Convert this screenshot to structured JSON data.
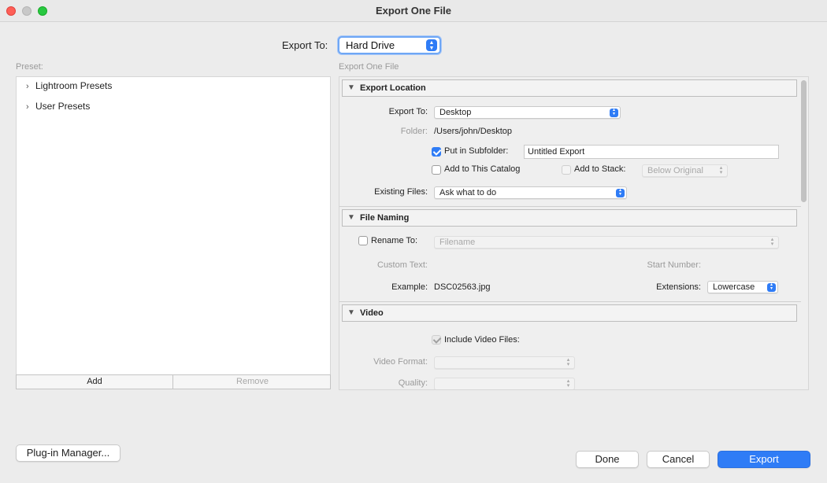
{
  "window": {
    "title": "Export One File"
  },
  "export_to": {
    "label": "Export To:",
    "value": "Hard Drive"
  },
  "preset": {
    "caption": "Preset:",
    "items": [
      {
        "label": "Lightroom Presets"
      },
      {
        "label": "User Presets"
      }
    ],
    "add_label": "Add",
    "remove_label": "Remove"
  },
  "settings_caption": "Export One File",
  "export_location": {
    "header": "Export Location",
    "export_to_label": "Export To:",
    "export_to_value": "Desktop",
    "folder_label": "Folder:",
    "folder_value": "/Users/john/Desktop",
    "subfolder_label": "Put in Subfolder:",
    "subfolder_checked": true,
    "subfolder_value": "Untitled Export",
    "add_catalog_label": "Add to This Catalog",
    "add_catalog_checked": false,
    "add_stack_label": "Add to Stack:",
    "add_stack_value": "Below Original",
    "existing_label": "Existing Files:",
    "existing_value": "Ask what to do"
  },
  "file_naming": {
    "header": "File Naming",
    "rename_label": "Rename To:",
    "rename_checked": false,
    "rename_value": "Filename",
    "custom_text_label": "Custom Text:",
    "start_number_label": "Start Number:",
    "example_label": "Example:",
    "example_value": "DSC02563.jpg",
    "extensions_label": "Extensions:",
    "extensions_value": "Lowercase"
  },
  "video": {
    "header": "Video",
    "include_label": "Include Video Files:",
    "include_checked": true,
    "format_label": "Video Format:",
    "quality_label": "Quality:"
  },
  "buttons": {
    "plugin_manager": "Plug-in Manager...",
    "done": "Done",
    "cancel": "Cancel",
    "export": "Export"
  },
  "colors": {
    "accent": "#2f7cf6",
    "close": "#fe5f57",
    "maximize": "#28c840"
  }
}
